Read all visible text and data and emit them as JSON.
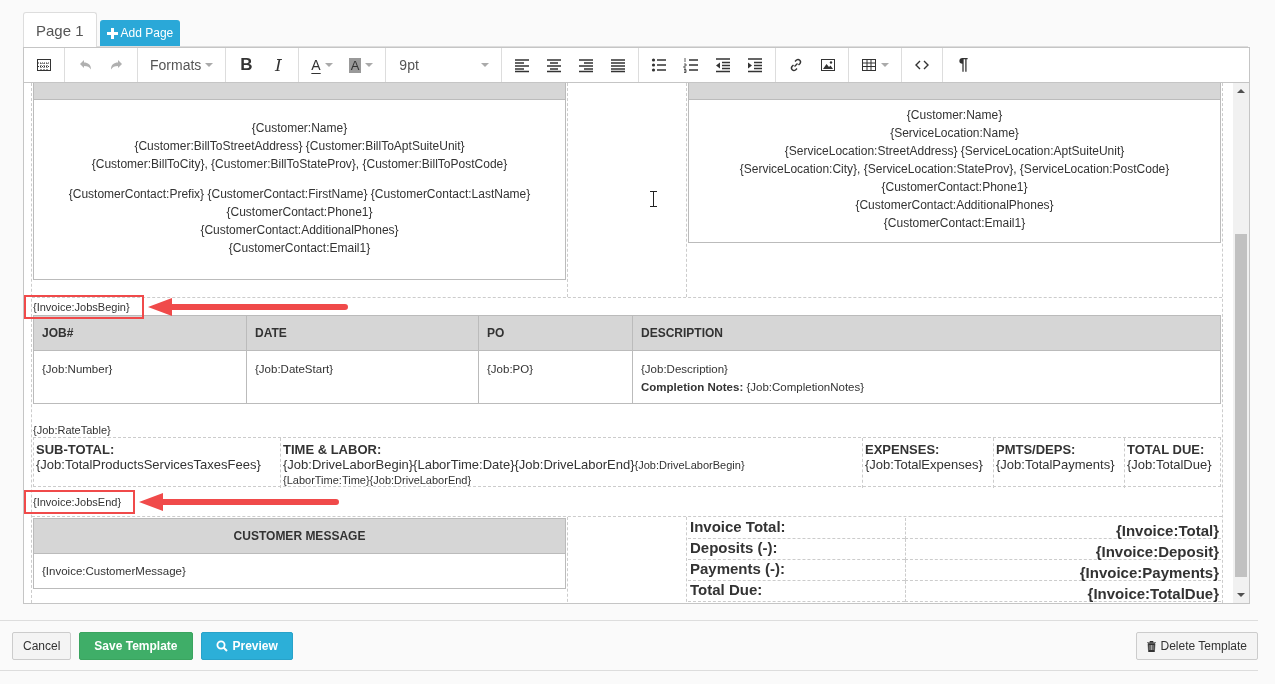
{
  "tabs": [
    {
      "label": "Page 1",
      "selected": true
    }
  ],
  "add_page_button": {
    "label": "Add Page"
  },
  "toolbar": [
    [
      {
        "kind": "grid",
        "disabled": false
      }
    ],
    [
      {
        "kind": "undo",
        "disabled": true
      },
      {
        "kind": "redo",
        "disabled": true
      }
    ],
    [
      {
        "kind": "dropdown",
        "label": "Formats",
        "disabled": false
      }
    ],
    [
      {
        "kind": "bold",
        "label": "B",
        "disabled": false
      },
      {
        "kind": "italic",
        "label": "I",
        "disabled": false
      }
    ],
    [
      {
        "kind": "forecolor",
        "label": "A",
        "disabled": false
      },
      {
        "kind": "backcolor",
        "label": "A",
        "disabled": false
      }
    ],
    [
      {
        "kind": "select",
        "label": "9pt",
        "disabled": false
      }
    ],
    [
      {
        "kind": "alignleft",
        "disabled": false
      },
      {
        "kind": "aligncenter",
        "disabled": false
      },
      {
        "kind": "alignright",
        "disabled": false
      },
      {
        "kind": "justify",
        "disabled": false
      }
    ],
    [
      {
        "kind": "bullets",
        "disabled": false
      },
      {
        "kind": "numbers",
        "disabled": false
      },
      {
        "kind": "outdent",
        "disabled": false
      },
      {
        "kind": "indent",
        "disabled": false
      }
    ],
    [
      {
        "kind": "link",
        "disabled": false
      },
      {
        "kind": "image",
        "disabled": false
      }
    ],
    [
      {
        "kind": "table",
        "disabled": false
      }
    ],
    [
      {
        "kind": "code",
        "disabled": false
      }
    ],
    [
      {
        "kind": "pilcrow",
        "label": "¶",
        "disabled": false
      }
    ]
  ],
  "document": {
    "bill_to": {
      "address_lines": [
        "{Customer:Name}",
        "{Customer:BillToStreetAddress} {Customer:BillToAptSuiteUnit}",
        "{Customer:BillToCity}, {Customer:BillToStateProv}, {Customer:BillToPostCode}"
      ],
      "contact_lines": [
        "{CustomerContact:Prefix} {CustomerContact:FirstName} {CustomerContact:LastName}",
        "{CustomerContact:Phone1}",
        "{CustomerContact:AdditionalPhones}",
        "{CustomerContact:Email1}"
      ]
    },
    "service_location": {
      "lines": [
        "{Customer:Name}",
        "{ServiceLocation:Name}",
        "{ServiceLocation:StreetAddress} {ServiceLocation:AptSuiteUnit}",
        "{ServiceLocation:City}, {ServiceLocation:StateProv}, {ServiceLocation:PostCode}",
        "{CustomerContact:Phone1}",
        "{CustomerContact:AdditionalPhones}",
        "{CustomerContact:Email1}"
      ]
    },
    "jobs_begin": {
      "text": "{Invoice:JobsBegin}",
      "highlighted": true
    },
    "jobs_table": {
      "columns": [
        "JOB#",
        "DATE",
        "PO",
        "DESCRIPTION"
      ],
      "cells": [
        [
          "{Job:Number}"
        ],
        [
          "{Job:DateStart}"
        ],
        [
          "{Job:PO}"
        ],
        [
          "{Job:Description}",
          "**Completion Notes:** {Job:CompletionNotes}"
        ]
      ]
    },
    "rate_table": "{Job:RateTable}",
    "totals_row": [
      {
        "label": "SUB-TOTAL:",
        "value": "{Job:TotalProductsServicesTaxesFees}"
      },
      {
        "label": "TIME & LABOR:",
        "value": "{Job:DriveLaborBegin}{LaborTime:Date}{Job:DriveLaborEnd}",
        "detail_lines": [
          "{Job:DriveLaborBegin}",
          "{LaborTime:Time}{Job:DriveLaborEnd}"
        ]
      },
      {
        "label": "EXPENSES:",
        "value": "{Job:TotalExpenses}"
      },
      {
        "label": "PMTS/DEPS:",
        "value": "{Job:TotalPayments}"
      },
      {
        "label": "TOTAL DUE:",
        "value": "{Job:TotalDue}"
      }
    ],
    "jobs_end": {
      "text": "{Invoice:JobsEnd}",
      "highlighted": true
    },
    "customer_message": {
      "header": "CUSTOMER MESSAGE",
      "body": "{Invoice:CustomerMessage}"
    },
    "invoice_totals": [
      {
        "label": "Invoice Total:",
        "value": "{Invoice:Total}"
      },
      {
        "label": "Deposits (-):",
        "value": "{Invoice:Deposit}"
      },
      {
        "label": "Payments (-):",
        "value": "{Invoice:Payments}"
      },
      {
        "label": "Total Due:",
        "value": "{Invoice:TotalDue}"
      }
    ]
  },
  "footer": {
    "left": [
      {
        "kind": "cancel",
        "label": "Cancel"
      },
      {
        "kind": "save",
        "label": "Save Template"
      },
      {
        "kind": "preview",
        "label": "Preview"
      }
    ],
    "right": [
      {
        "kind": "delete",
        "label": "Delete Template"
      }
    ]
  }
}
